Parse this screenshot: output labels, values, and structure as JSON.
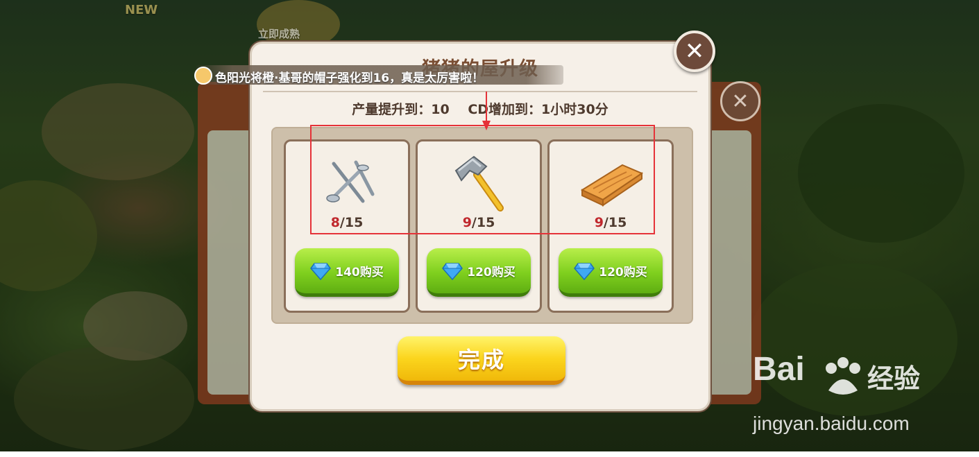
{
  "background": {
    "badge_new": "NEW",
    "harvest_label": "立即成熟"
  },
  "marquee": {
    "text": "色阳光将橙·基哥的帽子强化到16，真是太厉害啦！"
  },
  "dialog": {
    "title": "猪猪的屋升级",
    "stats": {
      "output": "产量提升到：10",
      "cd": "CD增加到：1小时30分"
    },
    "items": [
      {
        "icon": "nails-icon",
        "have": "8",
        "need": "/15",
        "buy_label": "140购买"
      },
      {
        "icon": "hammer-icon",
        "have": "9",
        "need": "/15",
        "buy_label": "120购买"
      },
      {
        "icon": "wood-plank-icon",
        "have": "9",
        "need": "/15",
        "buy_label": "120购买"
      }
    ],
    "done_label": "完成"
  },
  "watermark": {
    "brand_a": "Bai",
    "brand_b": "经验",
    "url": "jingyan.baidu.com"
  },
  "colors": {
    "dialog_bg": "#f6f0e8",
    "title": "#7a4e33",
    "have_count": "#c0282d",
    "buy_green": "#7fcf1e",
    "done_yellow": "#fbd51d",
    "highlight_red": "#e53238"
  }
}
